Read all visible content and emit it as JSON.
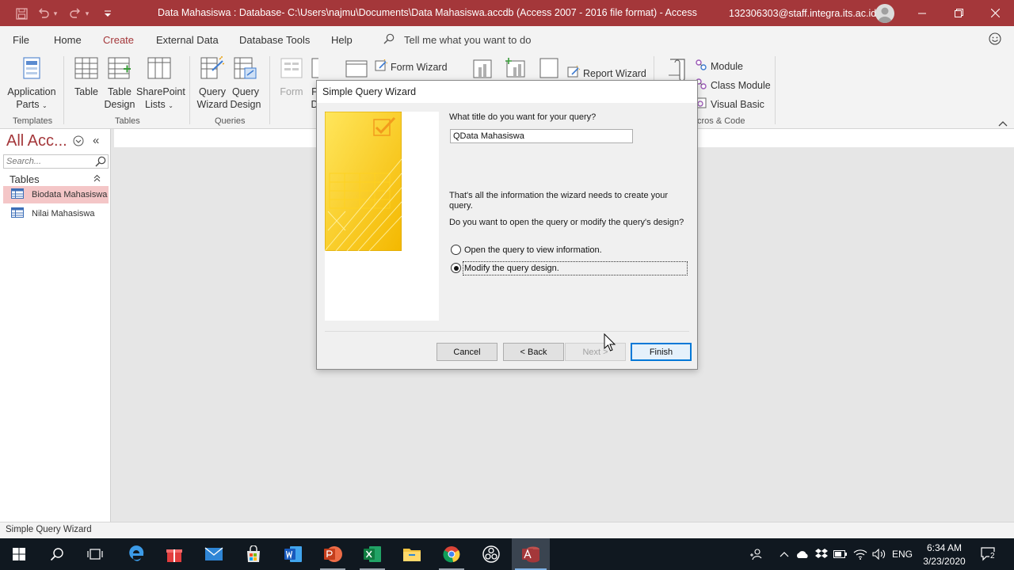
{
  "titlebar": {
    "title": "Data Mahasiswa : Database- C:\\Users\\najmu\\Documents\\Data Mahasiswa.accdb (Access 2007 - 2016 file format)  -  Access",
    "account": "132306303@staff.integra.its.ac.id",
    "accent_color": "#a4373a"
  },
  "ribbon_tabs": {
    "file": "File",
    "home": "Home",
    "create": "Create",
    "external_data": "External Data",
    "database_tools": "Database Tools",
    "help": "Help",
    "tell_me": "Tell me what you want to do",
    "active": "Create"
  },
  "ribbon": {
    "application_parts": [
      "Application",
      "Parts"
    ],
    "table": "Table",
    "table_design": [
      "Table",
      "Design"
    ],
    "sharepoint_lists": [
      "SharePoint",
      "Lists"
    ],
    "query_wizard": [
      "Query",
      "Wizard"
    ],
    "query_design": [
      "Query",
      "Design"
    ],
    "form": "Form",
    "form_wizard": "Form Wizard",
    "report_wizard": "Report Wizard",
    "module": "Module",
    "class_module": "Class Module",
    "visual_basic": "Visual Basic",
    "groups": {
      "templates": "Templates",
      "tables": "Tables",
      "queries": "Queries",
      "macros_code": "cros & Code"
    },
    "partial_f": "F",
    "partial_d": "D"
  },
  "navpane": {
    "header": "All Acc...",
    "search_placeholder": "Search...",
    "section": "Tables",
    "items": [
      {
        "label": "Biodata Mahasiswa",
        "selected": true
      },
      {
        "label": "Nilai Mahasiswa",
        "selected": false
      }
    ]
  },
  "dialog": {
    "title": "Simple Query Wizard",
    "prompt": "What title do you want for your query?",
    "query_title": "QData Mahasiswa",
    "info_line1": "That's all the information the wizard needs to create your",
    "info_line2": "query.",
    "question": "Do you want to open the query or modify the query's design?",
    "option_open": "Open the query to view information.",
    "option_modify": "Modify the query design.",
    "selected_option": "modify",
    "buttons": {
      "cancel": "Cancel",
      "back": "< Back",
      "next": "Next >",
      "finish": "Finish"
    }
  },
  "statusbar": {
    "text": "Simple Query Wizard"
  },
  "taskbar": {
    "language": "ENG",
    "time": "6:34 AM",
    "date": "3/23/2020",
    "notification_count": "2"
  }
}
